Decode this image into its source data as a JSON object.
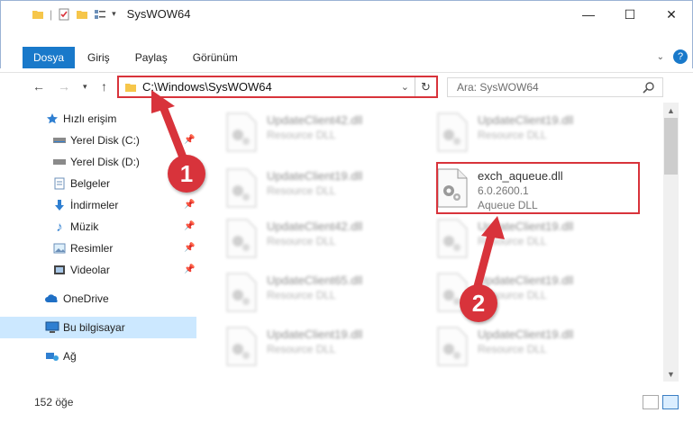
{
  "window": {
    "title": "SysWOW64",
    "minimize": "—",
    "maximize": "☐",
    "close": "✕"
  },
  "ribbon": {
    "tabs": [
      "Dosya",
      "Giriş",
      "Paylaş",
      "Görünüm"
    ],
    "expand_icon": "chevron-down-icon",
    "help": "?"
  },
  "address": {
    "path": "C:\\Windows\\SysWOW64",
    "refresh": "↻"
  },
  "search": {
    "placeholder": "Ara: SysWOW64"
  },
  "sidebar": {
    "items": [
      {
        "label": "Hızlı erişim",
        "icon": "star-icon"
      },
      {
        "label": "Yerel Disk (C:)",
        "icon": "drive-icon"
      },
      {
        "label": "Yerel Disk (D:)",
        "icon": "drive-icon"
      },
      {
        "label": "Belgeler",
        "icon": "documents-icon"
      },
      {
        "label": "İndirmeler",
        "icon": "download-icon"
      },
      {
        "label": "Müzik",
        "icon": "music-icon"
      },
      {
        "label": "Resimler",
        "icon": "pictures-icon"
      },
      {
        "label": "Videolar",
        "icon": "videos-icon"
      },
      {
        "label": "OneDrive",
        "icon": "cloud-icon"
      },
      {
        "label": "Bu bilgisayar",
        "icon": "computer-icon"
      },
      {
        "label": "Ağ",
        "icon": "network-icon"
      }
    ]
  },
  "files": [
    {
      "name": "UpdateClient42.dll",
      "sub": "Resource DLL"
    },
    {
      "name": "UpdateClient19.dll",
      "sub": "Resource DLL"
    },
    {
      "name": "UpdateClient19.dll",
      "sub": "Resource DLL"
    },
    {
      "name": "exch_aqueue.dll",
      "version": "6.0.2600.1",
      "sub": "Aqueue DLL"
    },
    {
      "name": "UpdateClient42.dll",
      "sub": "Resource DLL"
    },
    {
      "name": "UpdateClient19.dll",
      "sub": "Resource DLL"
    },
    {
      "name": "UpdateClient65.dll",
      "sub": "Resource DLL"
    },
    {
      "name": "UpdateClient19.dll",
      "sub": "Resource DLL"
    },
    {
      "name": "UpdateClient19.dll",
      "sub": "Resource DLL"
    },
    {
      "name": "UpdateClient19.dll",
      "sub": "Resource DLL"
    }
  ],
  "status": {
    "count": "152 öğe"
  },
  "annotations": {
    "step1": "1",
    "step2": "2",
    "color": "#d8333b"
  }
}
